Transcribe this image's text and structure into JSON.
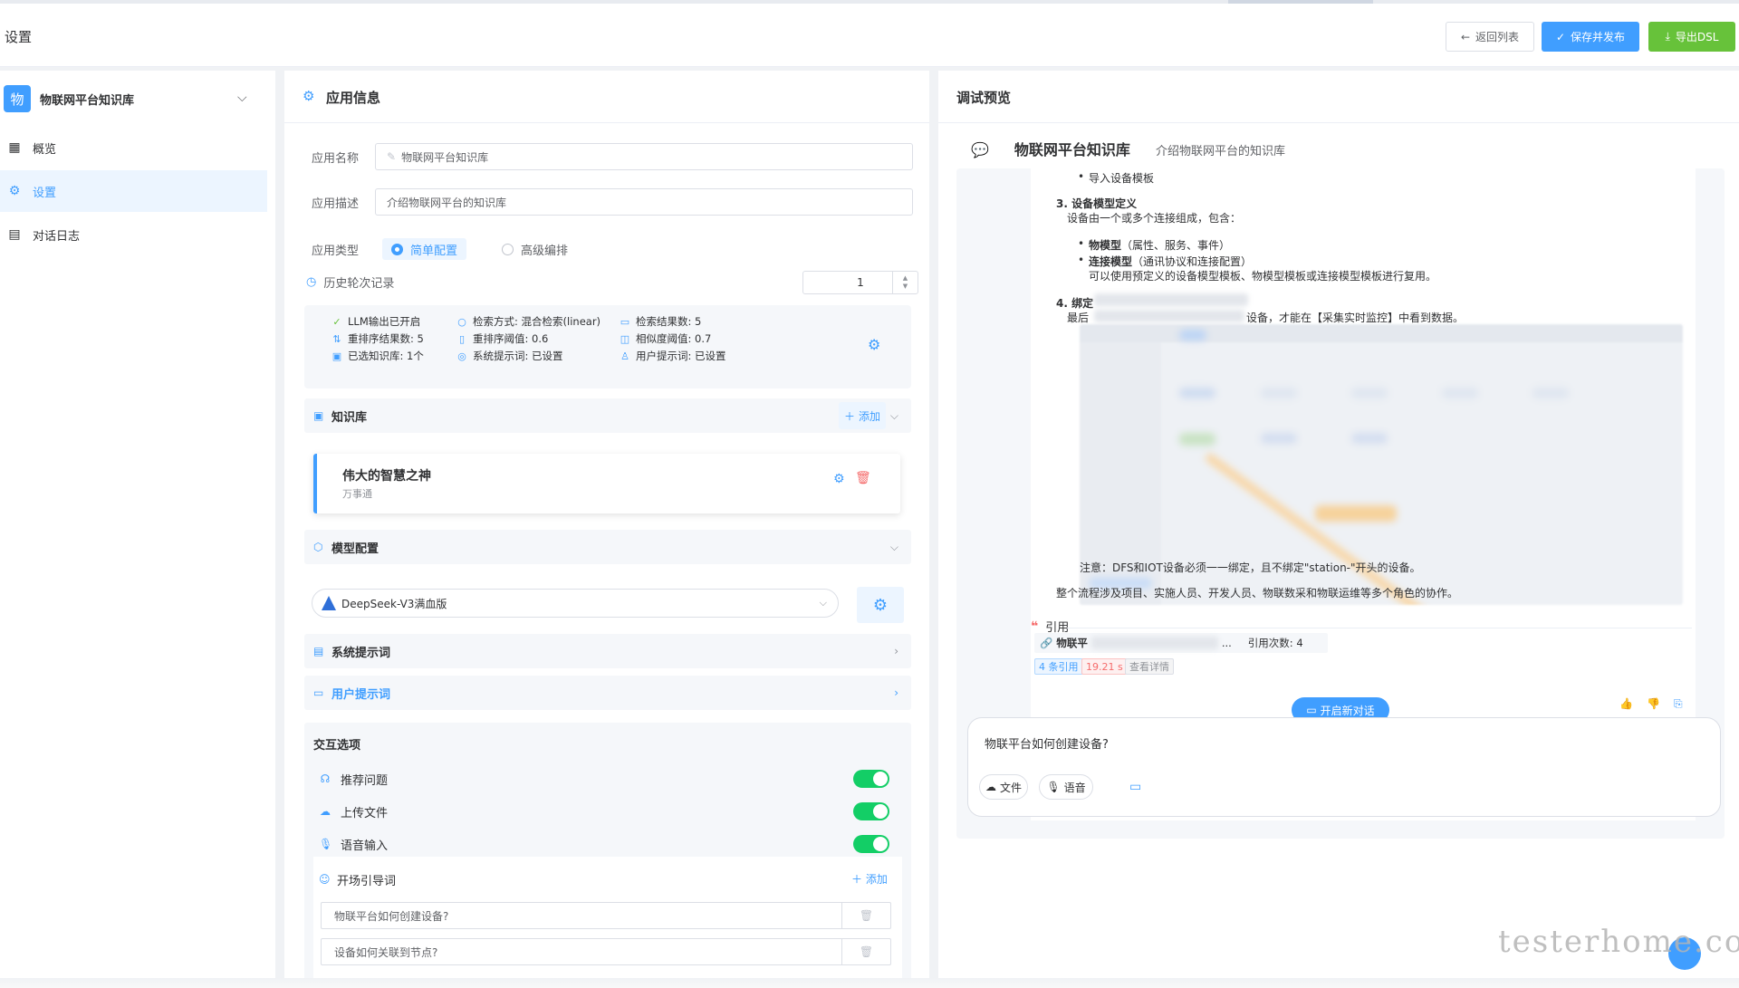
{
  "header": {
    "title": "设置",
    "back_label": "返回列表",
    "save_label": "保存并发布",
    "export_label": "导出DSL",
    "back_icon": "←",
    "save_icon": "✓",
    "export_icon": "⤓"
  },
  "sidebar": {
    "kb_avatar": "物",
    "kb_name": "物联网平台知识库",
    "items": [
      {
        "label": "概览",
        "icon": "grid-icon"
      },
      {
        "label": "设置",
        "icon": "gear-icon",
        "active": true
      },
      {
        "label": "对话日志",
        "icon": "doc-icon"
      }
    ]
  },
  "app_info": {
    "title": "应用信息",
    "name_label": "应用名称",
    "name_value": "物联网平台知识库",
    "desc_label": "应用描述",
    "desc_value": "介绍物联网平台的知识库",
    "type_label": "应用类型",
    "type_simple": "简单配置",
    "type_advanced": "高级编排",
    "history_label": "历史轮次记录",
    "history_value": "1"
  },
  "summary": {
    "llm": "LLM输出已开启",
    "search_mode": "检索方式: 混合检索(linear)",
    "search_count": "检索结果数: 5",
    "rerank_count": "重排序结果数: 5",
    "rerank_threshold": "重排序阈值: 0.6",
    "sim_threshold": "相似度阈值: 0.7",
    "kb_selected": "已选知识库: 1个",
    "sys_prompt": "系统提示词: 已设置",
    "user_prompt": "用户提示词: 已设置"
  },
  "knowledge": {
    "title": "知识库",
    "add_label": "添加",
    "card_name": "伟大的智慧之神",
    "card_sub": "万事通"
  },
  "model": {
    "title": "模型配置",
    "selected": "DeepSeek-V3满血版"
  },
  "prompts": {
    "system": "系统提示词",
    "user": "用户提示词"
  },
  "interaction": {
    "title": "交互选项",
    "recommend": "推荐问题",
    "upload": "上传文件",
    "voice": "语音输入",
    "recommend_on": true,
    "upload_on": true,
    "voice_on": true,
    "guide_title": "开场引导词",
    "guide_add": "添加",
    "questions": [
      "物联平台如何创建设备?",
      "设备如何关联到节点?"
    ]
  },
  "preview": {
    "title": "调试预览",
    "chat_name": "物联网平台知识库",
    "chat_desc": "介绍物联网平台的知识库",
    "lines": {
      "l1": "导入设备模板",
      "l2": "3. 设备模型定义",
      "l3": "设备由一个或多个连接组成，包含：",
      "l4a": "物模型",
      "l4b": "（属性、服务、事件）",
      "l5a": "连接模型",
      "l5b": "（通讯协议和连接配置）",
      "l6": "可以使用预定义的设备模型模板、物模型模板或连接模型模板进行复用。",
      "l7": "4. 绑定",
      "l8a": "最后",
      "l8b": "设备，才能在【采集实时监控】中看到数据。",
      "l9": "注意：DFS和IOT设备必须一一绑定，且不绑定\"station-\"开头的设备。",
      "l10": "整个流程涉及项目、实施人员、开发人员、物联数采和物联运维等多个角色的协作。"
    },
    "cite_title": "引用",
    "cite_doc": "物联平",
    "cite_count": "引用次数: 4",
    "tag_refs": "4 条引用",
    "tag_time": "19.21 s",
    "tag_detail": "查看详情",
    "new_chat": "开启新对话",
    "input_text": "物联平台如何创建设备?",
    "file_btn": "文件",
    "voice_btn": "语音"
  },
  "watermark": "testerhome.com"
}
